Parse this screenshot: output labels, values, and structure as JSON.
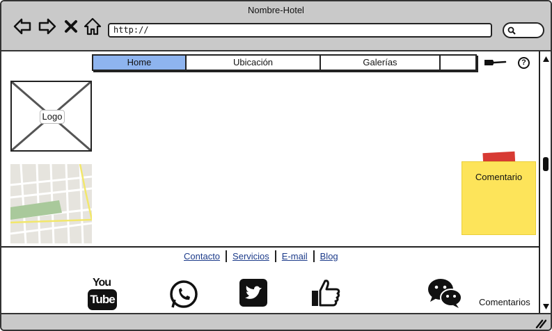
{
  "window": {
    "title": "Nombre-Hotel"
  },
  "toolbar": {
    "url": "http://"
  },
  "tabs": [
    {
      "label": "Home",
      "active": true
    },
    {
      "label": "Ubicación",
      "active": false
    },
    {
      "label": "Galerías",
      "active": false
    },
    {
      "label": "",
      "active": false
    }
  ],
  "logo": {
    "label": "Logo"
  },
  "note": {
    "text": "Comentario"
  },
  "footer": {
    "links": [
      "Contacto",
      "Servicios",
      "E-mail",
      "Blog"
    ],
    "youtube_top": "You",
    "youtube_box": "Tube",
    "comments_label": "Comentarios"
  },
  "icons": [
    "back-icon",
    "forward-icon",
    "close-icon",
    "home-icon",
    "search-icon",
    "mic-icon",
    "help-icon",
    "whatsapp-icon",
    "twitter-icon",
    "like-icon",
    "wechat-icon"
  ],
  "colors": {
    "tab_active": "#8eb4ef",
    "note": "#fde45a",
    "tape": "#d73a33",
    "link": "#1c3b8a"
  }
}
